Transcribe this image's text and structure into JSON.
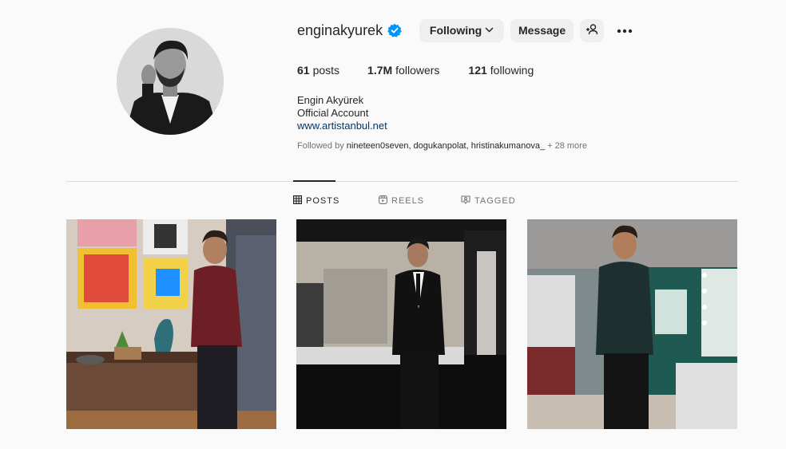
{
  "profile": {
    "username": "enginakyurek",
    "verified": true,
    "buttons": {
      "following_label": "Following",
      "message_label": "Message"
    },
    "stats": {
      "posts_count": "61",
      "posts_label": "posts",
      "followers_count": "1.7M",
      "followers_label": "followers",
      "following_count": "121",
      "following_label": "following"
    },
    "bio": {
      "full_name": "Engin Akyürek",
      "category": "Official Account",
      "link": "www.artistanbul.net"
    },
    "followed_by": {
      "prefix": "Followed by",
      "names": "nineteen0seven, dogukanpolat, hristinakumanova_",
      "more": "+ 28 more"
    }
  },
  "tabs": [
    {
      "label": "POSTS",
      "icon": "grid-icon",
      "active": true
    },
    {
      "label": "REELS",
      "icon": "reels-icon",
      "active": false
    },
    {
      "label": "TAGGED",
      "icon": "tagged-icon",
      "active": false
    }
  ],
  "colors": {
    "background": "#fafafa",
    "button_bg": "#efefef",
    "verified_blue": "#0095f6",
    "link": "#00376b",
    "muted": "#737373",
    "divider": "#dbdbdb"
  },
  "icons": {
    "verified": "verified-badge-icon",
    "following_chevron": "chevron-down-icon",
    "add_user": "add-user-icon",
    "more": "more-options-icon"
  }
}
